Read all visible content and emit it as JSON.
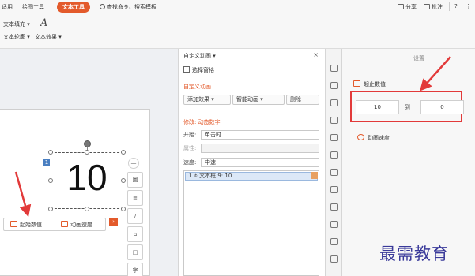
{
  "ribbon": {
    "tabs": [
      "适用",
      "绘图工具",
      "文本工具"
    ],
    "search_label": "查找命令、搜索模板",
    "share_label": "分享",
    "comment_label": "批注",
    "help_label": "?",
    "more_label": "⋮",
    "text_fill": "文本填充 ▾",
    "text_outline": "文本轮廓 ▾",
    "text_effect": "文本效果 ▾",
    "text_art_glyph": "A"
  },
  "slide": {
    "number": "10",
    "badge": "1",
    "float_bar": {
      "start_value": "起始数值",
      "anim_speed": "动画速度",
      "more": "›"
    },
    "mini_tools": [
      "—",
      "圖",
      "≡",
      "/",
      "⌂",
      "□",
      "字"
    ]
  },
  "anim_pane": {
    "title": "自定义动画 ▾",
    "close": "×",
    "select_pane": "选择窗格",
    "section_title": "自定义动画",
    "add_effect": "添加效果",
    "smart_anim": "智能动画",
    "delete": "删除",
    "modify_label": "修改: 动态数字",
    "start_label": "开始:",
    "start_value": "单击时",
    "property_label": "属性:",
    "property_value": "",
    "speed_label": "速度:",
    "speed_value": "中速",
    "list_item": "1  ⌽  文本框 9: 10"
  },
  "settings": {
    "title": "设置",
    "start_end_label": "起止数值",
    "from_value": "10",
    "to_label": "到",
    "to_value": "0",
    "speed_label": "动画速度"
  },
  "watermark": "最需教育",
  "colors": {
    "accent": "#e35a2b",
    "highlight_red": "#e23a3a"
  }
}
